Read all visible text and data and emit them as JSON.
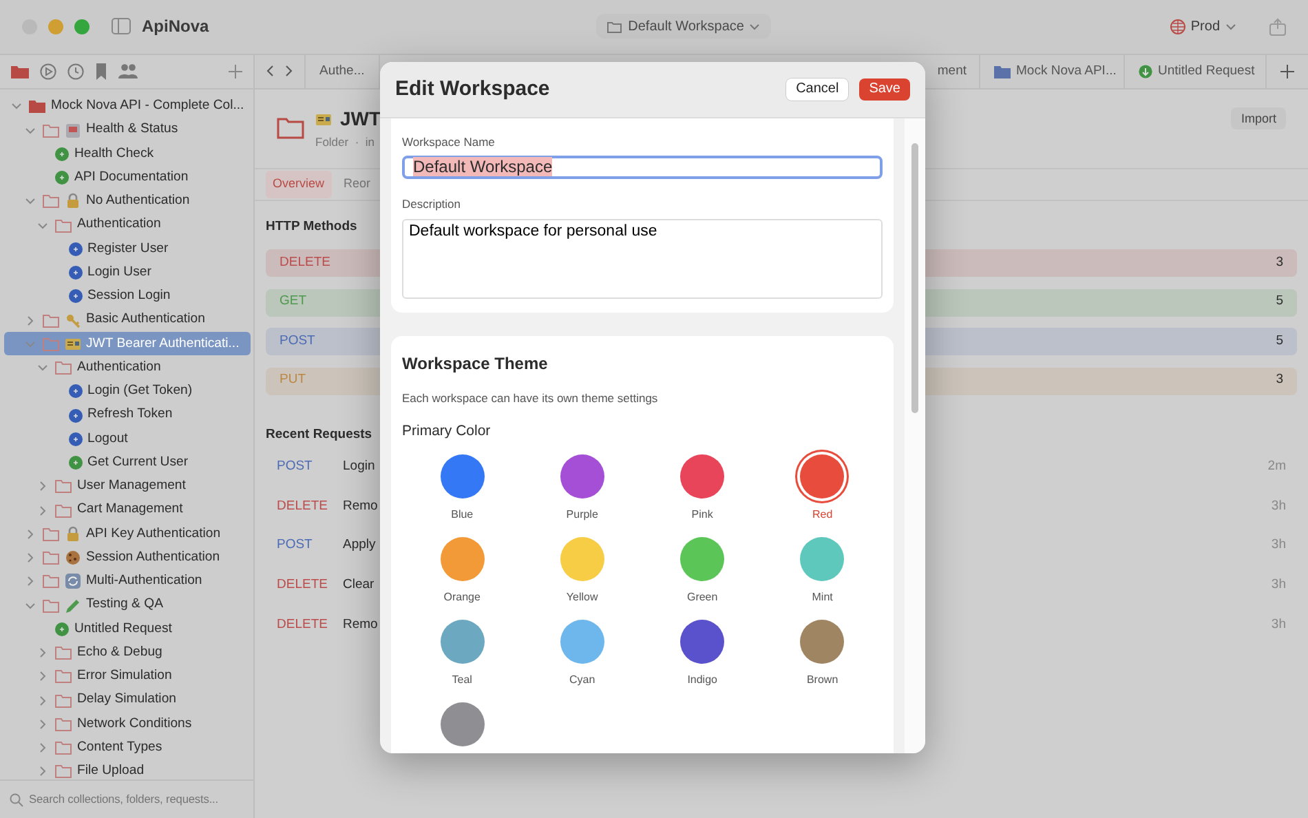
{
  "app": {
    "title": "ApiNova",
    "workspace": "Default Workspace",
    "environment": "Prod"
  },
  "sidebar": {
    "tree": [
      {
        "label": "Mock Nova API - Complete Col...",
        "kind": "collection",
        "expanded": true,
        "selected": false,
        "children": [
          {
            "label": "Health & Status",
            "kind": "folder",
            "emblem": {
              "kind": "building"
            },
            "expanded": true,
            "selected": false,
            "children": [
              {
                "label": "Health Check",
                "kind": "request",
                "color": "#409343"
              },
              {
                "label": "API Documentation",
                "kind": "request",
                "color": "#409343"
              }
            ]
          },
          {
            "label": "No Authentication",
            "kind": "folder",
            "emblem": {
              "kind": "lock"
            },
            "expanded": true,
            "selected": false,
            "children": [
              {
                "label": "Authentication",
                "kind": "folder",
                "expanded": true,
                "selected": false,
                "children": [
                  {
                    "label": "Register User",
                    "kind": "request",
                    "color": "#355db5"
                  },
                  {
                    "label": "Login User",
                    "kind": "request",
                    "color": "#355db5"
                  },
                  {
                    "label": "Session Login",
                    "kind": "request",
                    "color": "#355db5"
                  }
                ]
              }
            ]
          },
          {
            "label": "Basic Authentication",
            "kind": "folder",
            "emblem": {
              "kind": "key"
            },
            "expanded": false,
            "selected": false
          },
          {
            "label": "JWT Bearer Authenticati...",
            "kind": "folder",
            "emblem": {
              "kind": "card"
            },
            "expanded": true,
            "selected": true,
            "children": [
              {
                "label": "Authentication",
                "kind": "folder",
                "expanded": true,
                "selected": false,
                "children": [
                  {
                    "label": "Login (Get Token)",
                    "kind": "request",
                    "color": "#355db5"
                  },
                  {
                    "label": "Refresh Token",
                    "kind": "request",
                    "color": "#355db5"
                  },
                  {
                    "label": "Logout",
                    "kind": "request",
                    "color": "#355db5"
                  },
                  {
                    "label": "Get Current User",
                    "kind": "request",
                    "color": "#409343"
                  }
                ]
              },
              {
                "label": "User Management",
                "kind": "folder",
                "expanded": false,
                "selected": false
              },
              {
                "label": "Cart Management",
                "kind": "folder",
                "expanded": false,
                "selected": false
              }
            ]
          },
          {
            "label": "API Key Authentication",
            "kind": "folder",
            "emblem": {
              "kind": "lock"
            },
            "expanded": false,
            "selected": false
          },
          {
            "label": "Session Authentication",
            "kind": "folder",
            "emblem": {
              "kind": "cookie"
            },
            "expanded": false,
            "selected": false
          },
          {
            "label": "Multi-Authentication",
            "kind": "folder",
            "emblem": {
              "kind": "sync"
            },
            "expanded": false,
            "selected": false
          },
          {
            "label": "Testing & QA",
            "kind": "folder",
            "emblem": {
              "kind": "pencil"
            },
            "expanded": true,
            "selected": false,
            "children": [
              {
                "label": "Untitled Request",
                "kind": "request",
                "color": "#409343"
              },
              {
                "label": "Echo & Debug",
                "kind": "folder",
                "expanded": false,
                "selected": false
              },
              {
                "label": "Error Simulation",
                "kind": "folder",
                "expanded": false,
                "selected": false
              },
              {
                "label": "Delay Simulation",
                "kind": "folder",
                "expanded": false,
                "selected": false
              },
              {
                "label": "Network Conditions",
                "kind": "folder",
                "expanded": false,
                "selected": false
              },
              {
                "label": "Content Types",
                "kind": "folder",
                "expanded": false,
                "selected": false
              },
              {
                "label": "File Upload",
                "kind": "folder",
                "expanded": false,
                "selected": false
              }
            ]
          }
        ]
      }
    ],
    "search_placeholder": "Search collections, folders, requests..."
  },
  "tabs": [
    {
      "label": "Authe...",
      "kind": "plain"
    },
    {
      "label": "ment",
      "kind": "plain"
    },
    {
      "label": "Mock Nova API...",
      "kind": "folder"
    },
    {
      "label": "Untitled Request",
      "kind": "request"
    }
  ],
  "folder": {
    "title": "JWT",
    "subtitle": "Folder  ·  in",
    "import": "Import",
    "view_tabs": [
      {
        "label": "Overview",
        "selected": true
      },
      {
        "label": "Reor",
        "selected": false
      }
    ],
    "methods_heading": "HTTP Methods",
    "methods": [
      {
        "method": "DELETE",
        "count": "3",
        "color": "#bc4c4c"
      },
      {
        "method": "GET",
        "count": "5",
        "color": "#4d9a4d"
      },
      {
        "method": "POST",
        "count": "5",
        "color": "#4c6bb4"
      },
      {
        "method": "PUT",
        "count": "3",
        "color": "#bc8643"
      }
    ],
    "recent_heading": "Recent Requests",
    "recent": [
      {
        "method": "POST",
        "name": "Login",
        "time": "2m",
        "color": "#4c6bb4"
      },
      {
        "method": "DELETE",
        "name": "Remo",
        "time": "3h",
        "color": "#bc4c4c"
      },
      {
        "method": "POST",
        "name": "Apply",
        "time": "3h",
        "color": "#4c6bb4"
      },
      {
        "method": "DELETE",
        "name": "Clear",
        "time": "3h",
        "color": "#bc4c4c"
      },
      {
        "method": "DELETE",
        "name": "Remo",
        "time": "3h",
        "color": "#bc4c4c"
      }
    ]
  },
  "modal": {
    "title": "Edit Workspace",
    "cancel": "Cancel",
    "save": "Save",
    "name_label": "Workspace Name",
    "name_value": "Default Workspace",
    "name_focused": true,
    "description_label": "Description",
    "description_value": "Default workspace for personal use",
    "theme_title": "Workspace Theme",
    "theme_hint": "Each workspace can have its own theme settings",
    "primary_color_label": "Primary Color",
    "colors": [
      {
        "name": "Blue",
        "color": "#3478f6",
        "selected": false
      },
      {
        "name": "Purple",
        "color": "#a54fd6",
        "selected": false
      },
      {
        "name": "Pink",
        "color": "#e8445a",
        "selected": false
      },
      {
        "name": "Red",
        "color": "#e84c3d",
        "selected": true
      },
      {
        "name": "Orange",
        "color": "#f29a38",
        "selected": false
      },
      {
        "name": "Yellow",
        "color": "#f7cd45",
        "selected": false
      },
      {
        "name": "Green",
        "color": "#5bc657",
        "selected": false
      },
      {
        "name": "Mint",
        "color": "#5ec8bd",
        "selected": false
      },
      {
        "name": "Teal",
        "color": "#6ca8c0",
        "selected": false
      },
      {
        "name": "Cyan",
        "color": "#6db7ec",
        "selected": false
      },
      {
        "name": "Indigo",
        "color": "#5a52cc",
        "selected": false
      },
      {
        "name": "Brown",
        "color": "#a08562",
        "selected": false
      },
      {
        "color": "#8e8e93",
        "selected": false
      }
    ]
  }
}
